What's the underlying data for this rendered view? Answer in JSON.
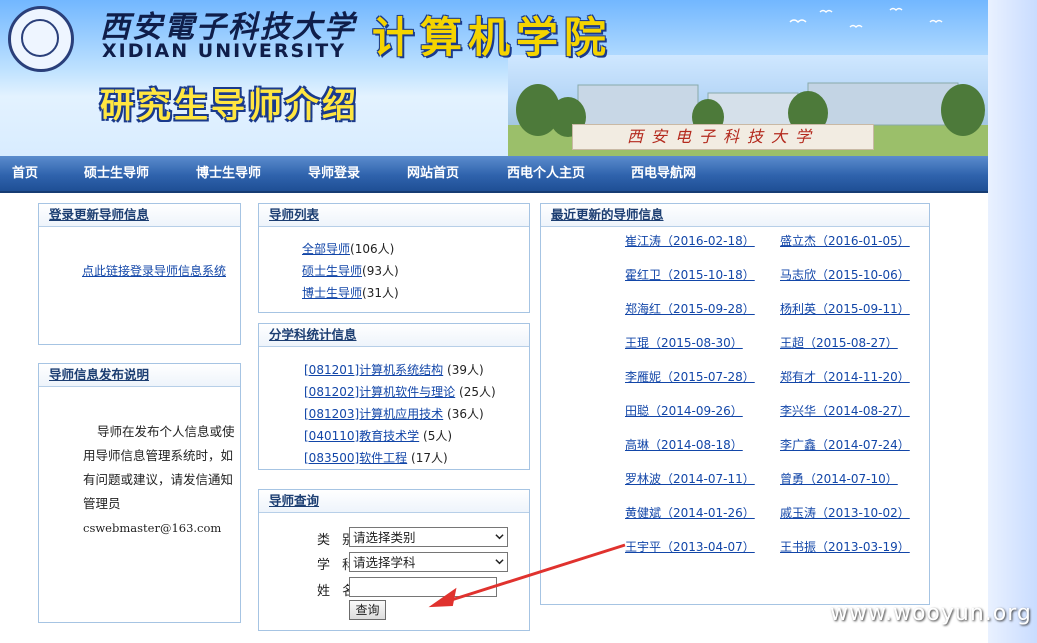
{
  "banner": {
    "university_cn": "西安電子科技大学",
    "university_en": "XIDIAN UNIVERSITY",
    "school": "计算机学院",
    "subtitle": "研究生导师介绍",
    "wall_text": "西安电子科技大学"
  },
  "nav": {
    "items": [
      "首页",
      "硕士生导师",
      "博士生导师",
      "导师登录",
      "网站首页",
      "西电个人主页",
      "西电导航网"
    ]
  },
  "login_panel": {
    "title": "登录更新导师信息",
    "link": "点此链接登录导师信息系统"
  },
  "notice_panel": {
    "title": "导师信息发布说明",
    "lines": [
      "导师在发布个人信息或使",
      "用导师信息管理系统时，如",
      "有问题或建议，请发信通知",
      "管理员"
    ],
    "email": "cswebmaster@163.com"
  },
  "tutor_list": {
    "title": "导师列表",
    "items": [
      {
        "label": "全部导师",
        "count": "(106人)"
      },
      {
        "label": "硕士生导师",
        "count": "(93人)"
      },
      {
        "label": "博士生导师",
        "count": "(31人)"
      }
    ]
  },
  "subject_stats": {
    "title": "分学科统计信息",
    "items": [
      {
        "label": "[081201]计算机系统结构",
        "count": "(39人)"
      },
      {
        "label": "[081202]计算机软件与理论",
        "count": "(25人)"
      },
      {
        "label": "[081203]计算机应用技术",
        "count": "(36人)"
      },
      {
        "label": "[040110]教育技术学",
        "count": "(5人)"
      },
      {
        "label": "[083500]软件工程",
        "count": "(17人)"
      }
    ]
  },
  "search": {
    "title": "导师查询",
    "category_label": "类 别",
    "category_value": "请选择类别",
    "subject_label": "学 科",
    "subject_value": "请选择学科",
    "name_label": "姓 名",
    "name_value": "",
    "button": "查询"
  },
  "recent": {
    "title": "最近更新的导师信息",
    "left": [
      "崔江涛（2016-02-18）",
      "霍红卫（2015-10-18）",
      "郑海红（2015-09-28）",
      "王琨（2015-08-30）",
      "李雁妮（2015-07-28）",
      "田聪（2014-09-26）",
      "高琳（2014-08-18）",
      "罗林波（2014-07-11）",
      "黄健斌（2014-01-26）",
      "王宇平（2013-04-07）"
    ],
    "right": [
      "盛立杰（2016-01-05）",
      "马志欣（2015-10-06）",
      "杨利英（2015-09-11）",
      "王超（2015-08-27）",
      "郑有才（2014-11-20）",
      "李兴华（2014-08-27）",
      "李广鑫（2014-07-24）",
      "曾勇（2014-07-10）",
      "戚玉涛（2013-10-02）",
      "王书振（2013-03-19）"
    ]
  },
  "watermark": "www.wooyun.org",
  "colors": {
    "nav_bg": "#2f63ad",
    "link": "#1246a8",
    "panel_border": "#a6c4e3",
    "annotation_arrow": "#e0322e"
  }
}
